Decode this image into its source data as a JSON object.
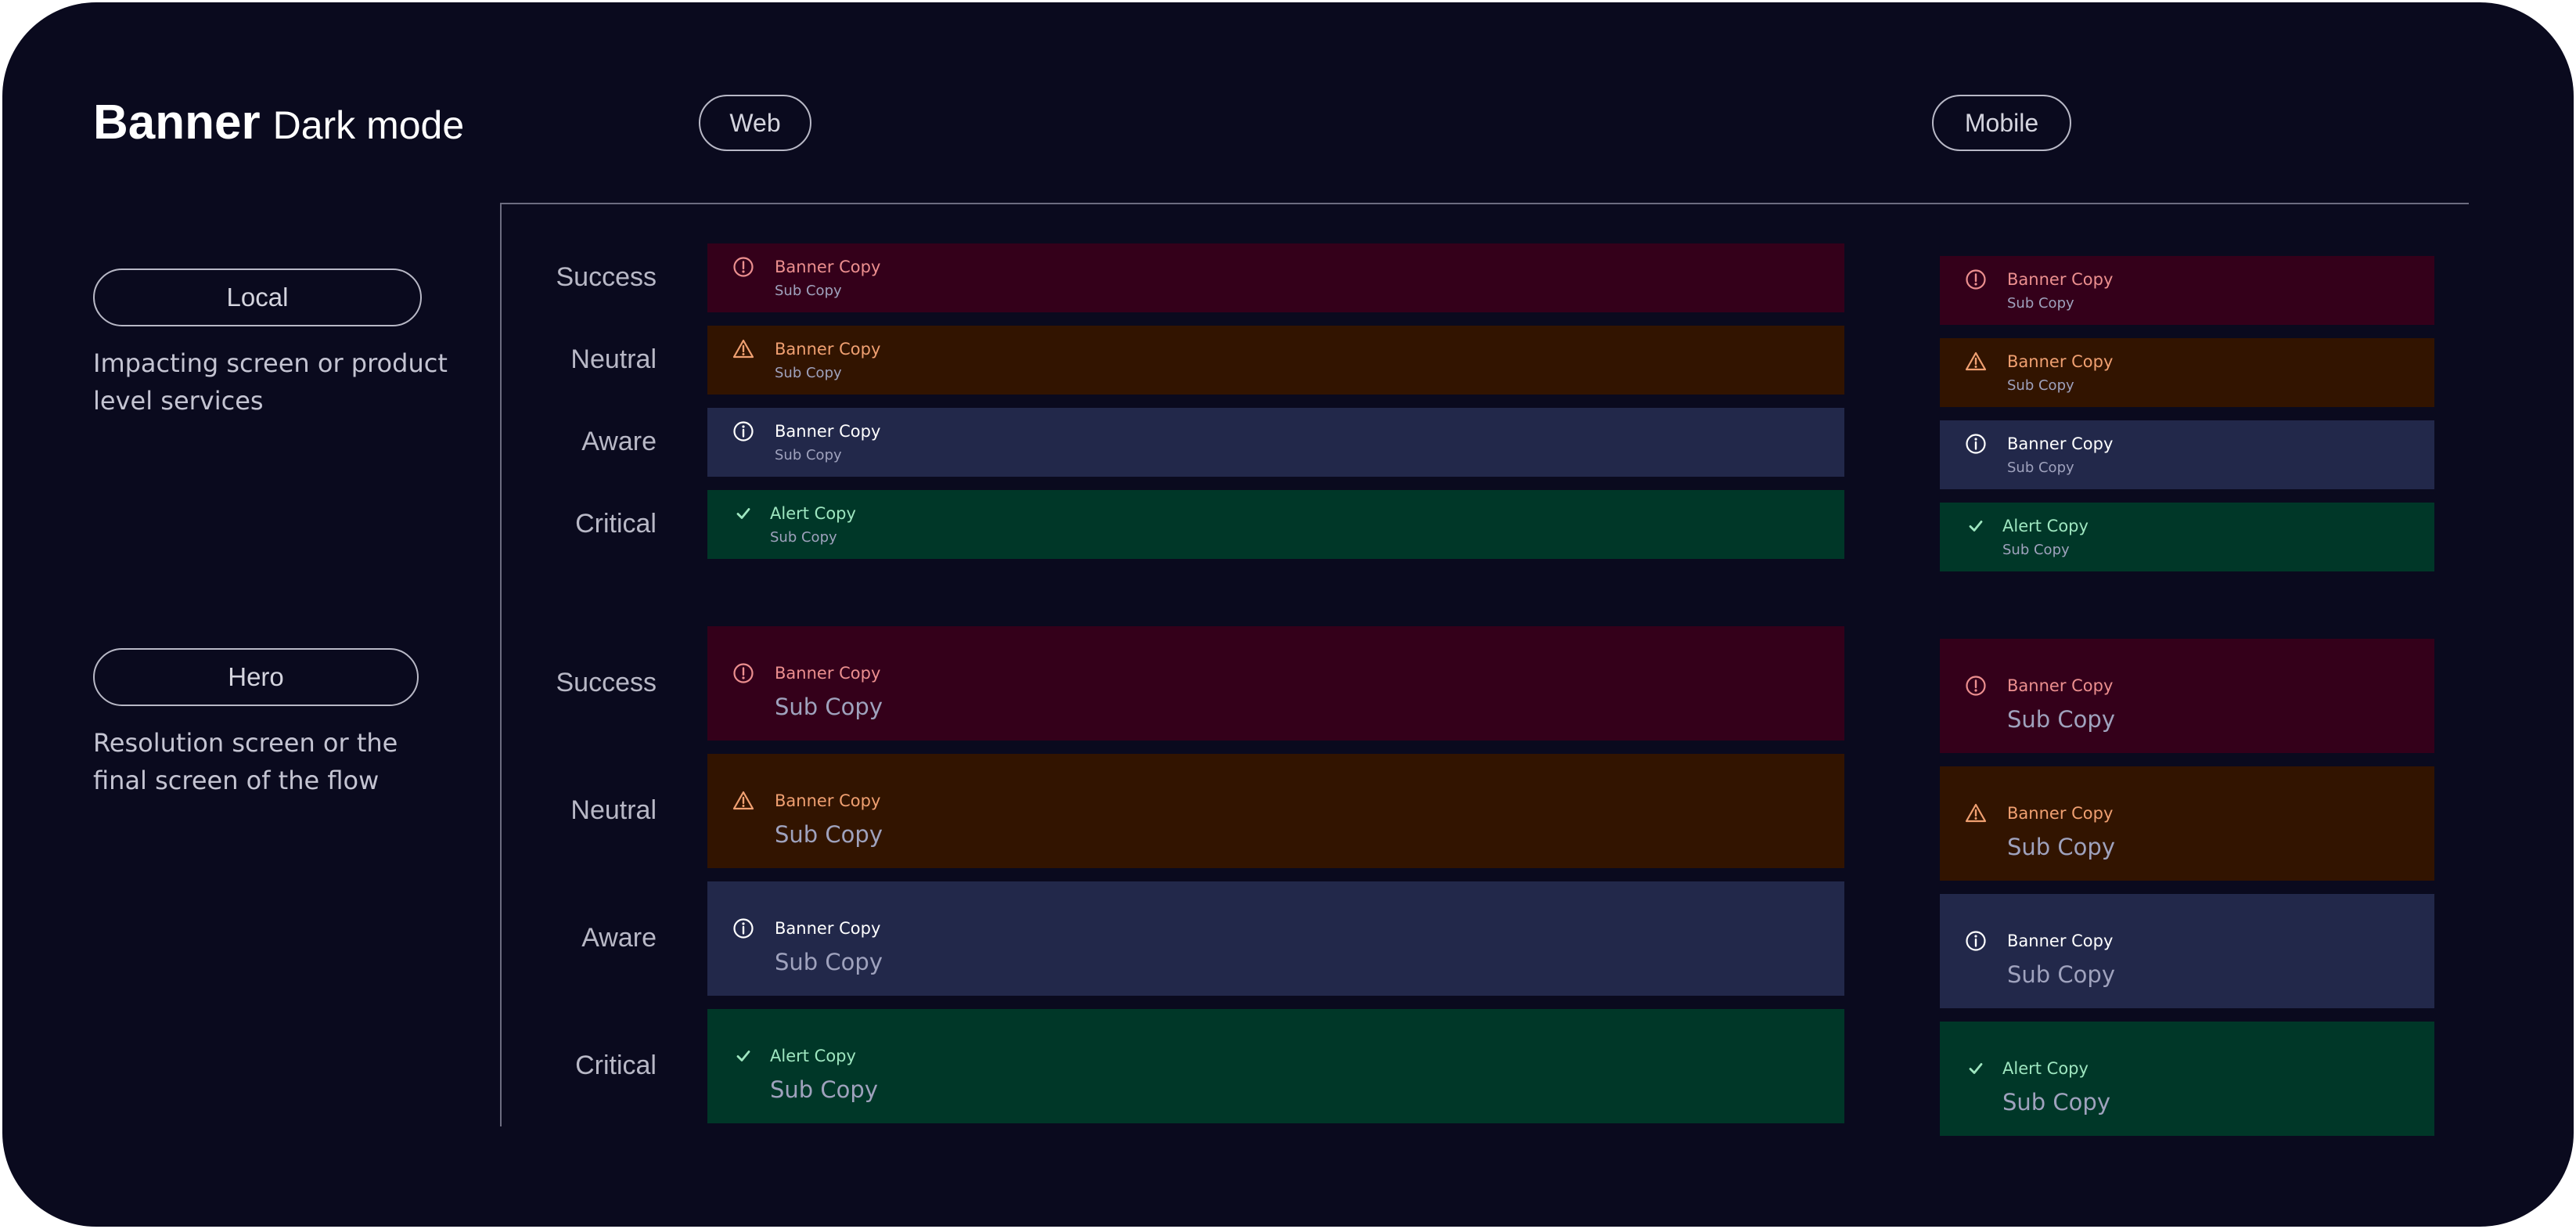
{
  "header": {
    "title_bold": "Banner",
    "title_rest": "Dark mode"
  },
  "platforms": {
    "web": "Web",
    "mobile": "Mobile"
  },
  "sections": {
    "local": {
      "label": "Local",
      "description": "Impacting screen or product level services"
    },
    "hero": {
      "label": "Hero",
      "description": "Resolution screen or the final screen of the flow"
    }
  },
  "rows": [
    {
      "label": "Success",
      "title": "Banner Copy",
      "sub": "Sub Copy",
      "icon": "alert-circle-icon"
    },
    {
      "label": "Neutral",
      "title": "Banner Copy",
      "sub": "Sub Copy",
      "icon": "warning-triangle-icon"
    },
    {
      "label": "Aware",
      "title": "Banner Copy",
      "sub": "Sub Copy",
      "icon": "info-circle-icon"
    },
    {
      "label": "Critical",
      "title": "Alert Copy",
      "sub": "Sub Copy",
      "icon": "checkmark-icon"
    }
  ],
  "colors": {
    "page_background": "#0a0a1e",
    "success_bg": "#34001a",
    "success_text": "#ec8f8f",
    "neutral_bg": "#321400",
    "neutral_text": "#f0a071",
    "aware_bg": "#22284a",
    "aware_text": "#ffffff",
    "critical_bg": "#003728",
    "critical_text": "#9ee6c0",
    "sub_text": "#9fa2bd"
  }
}
